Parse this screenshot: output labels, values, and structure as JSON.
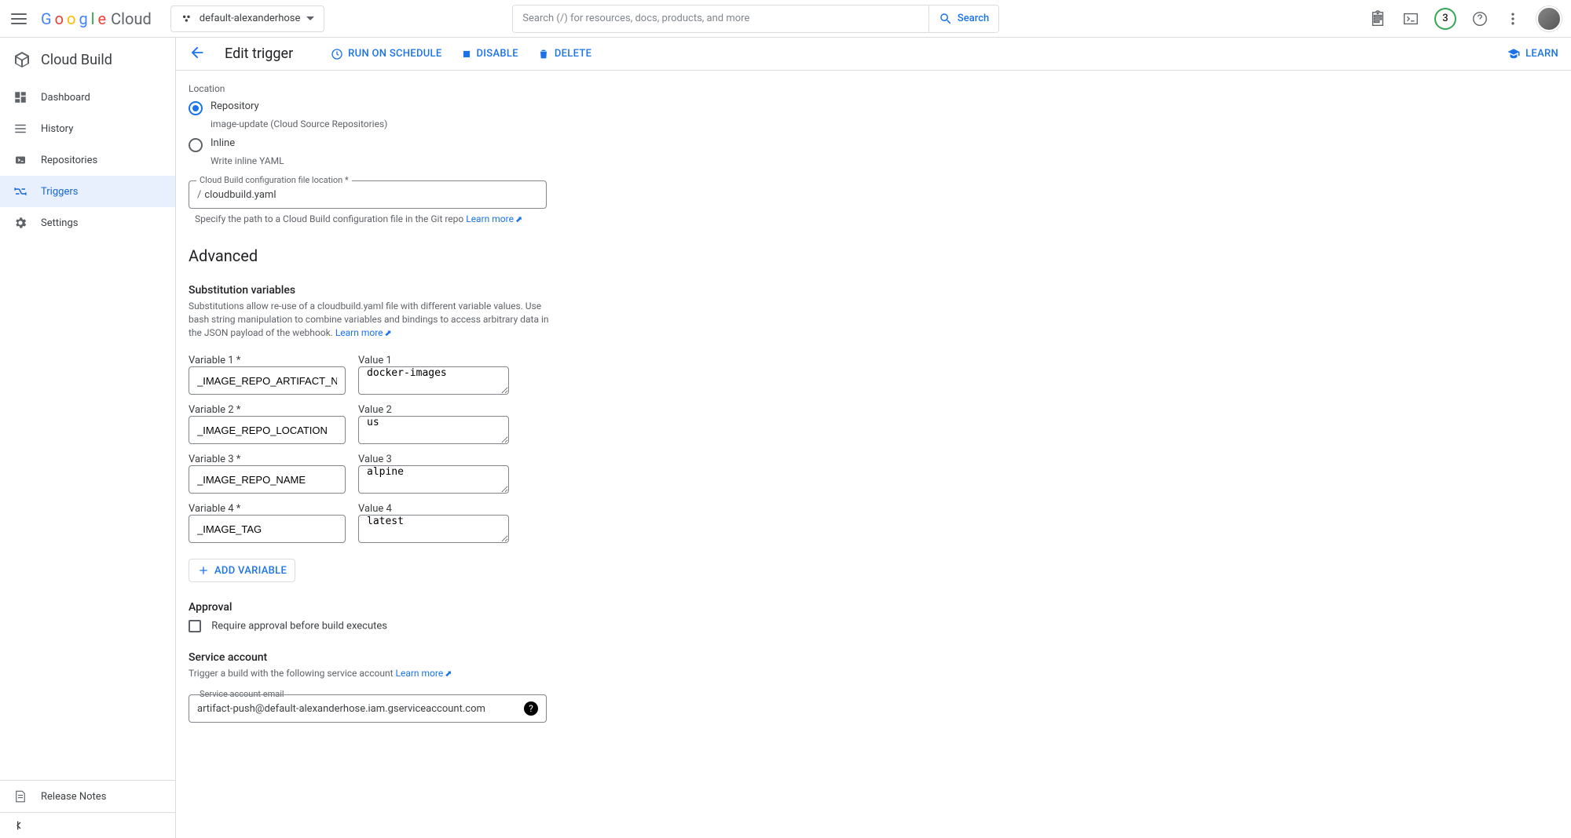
{
  "header": {
    "logo_cloud": "Cloud",
    "project": "default-alexanderhose",
    "search_placeholder": "Search (/) for resources, docs, products, and more",
    "search_button": "Search",
    "badge": "3"
  },
  "sidebar": {
    "service": "Cloud Build",
    "items": [
      {
        "label": "Dashboard"
      },
      {
        "label": "History"
      },
      {
        "label": "Repositories"
      },
      {
        "label": "Triggers"
      },
      {
        "label": "Settings"
      }
    ],
    "release_notes": "Release Notes"
  },
  "toolbar": {
    "title": "Edit trigger",
    "run_schedule": "RUN ON SCHEDULE",
    "disable": "DISABLE",
    "delete": "DELETE",
    "learn": "LEARN"
  },
  "form": {
    "location_label": "Location",
    "repo_label": "Repository",
    "repo_sub": "image-update (Cloud Source Repositories)",
    "inline_label": "Inline",
    "inline_sub": "Write inline YAML",
    "config_field_label": "Cloud Build configuration file location *",
    "config_prefix": "/",
    "config_value": "cloudbuild.yaml",
    "config_helper": "Specify the path to a Cloud Build configuration file in the Git repo",
    "learn_more": "Learn more",
    "advanced_heading": "Advanced",
    "subvars_heading": "Substitution variables",
    "subvars_desc": "Substitutions allow re-use of a cloudbuild.yaml file with different variable values. Use bash string manipulation to combine variables and bindings to access arbitrary data in the JSON payload of the webhook.",
    "variables": [
      {
        "var_label": "Variable 1 *",
        "var": "_IMAGE_REPO_ARTIFACT_NAME",
        "val_label": "Value 1",
        "val": "docker-images"
      },
      {
        "var_label": "Variable 2 *",
        "var": "_IMAGE_REPO_LOCATION",
        "val_label": "Value 2",
        "val": "us"
      },
      {
        "var_label": "Variable 3 *",
        "var": "_IMAGE_REPO_NAME",
        "val_label": "Value 3",
        "val": "alpine"
      },
      {
        "var_label": "Variable 4 *",
        "var": "_IMAGE_TAG",
        "val_label": "Value 4",
        "val": "latest"
      }
    ],
    "add_variable": "ADD VARIABLE",
    "approval_heading": "Approval",
    "approval_label": "Require approval before build executes",
    "sa_heading": "Service account",
    "sa_desc": "Trigger a build with the following service account",
    "sa_field_label": "Service account email",
    "sa_value": "artifact-push@default-alexanderhose.iam.gserviceaccount.com"
  }
}
